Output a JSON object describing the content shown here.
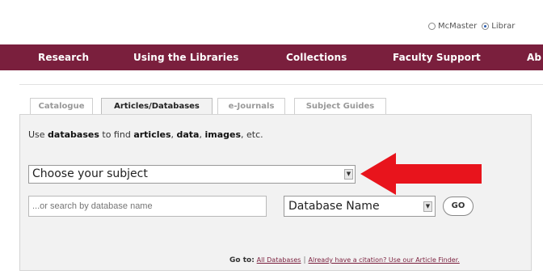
{
  "scope_selector": {
    "options": [
      {
        "label": "McMaster",
        "selected": false
      },
      {
        "label": "Librar",
        "selected": true
      }
    ]
  },
  "navbar": {
    "bg_color": "#7a1f3d",
    "items": [
      "Research",
      "Using the Libraries",
      "Collections",
      "Faculty Support",
      "Ab"
    ]
  },
  "search_tabs": {
    "items": [
      {
        "label": "Catalogue",
        "active": false
      },
      {
        "label": "Articles/Databases",
        "active": true
      },
      {
        "label": "e-Journals",
        "active": false
      },
      {
        "label": "Subject Guides",
        "active": false
      }
    ]
  },
  "intro": {
    "t1": "Use ",
    "b1": "databases",
    "t2": " to find ",
    "b2": "articles",
    "t3": ", ",
    "b3": "data",
    "t4": ", ",
    "b4": "images",
    "t5": ", etc."
  },
  "subject_select": {
    "value": "Choose your subject",
    "icon": "select-arrow-icon"
  },
  "annotation": {
    "color": "#e8141c",
    "icon": "red-arrow-icon"
  },
  "name_search": {
    "placeholder": "...or search by database name"
  },
  "field_select": {
    "value": "Database Name"
  },
  "go_button": {
    "label": "GO"
  },
  "goto": {
    "label": "Go to:",
    "link_all": "All Databases",
    "separator": "|",
    "link_citation": "Already have a citation? Use our Article Finder."
  }
}
